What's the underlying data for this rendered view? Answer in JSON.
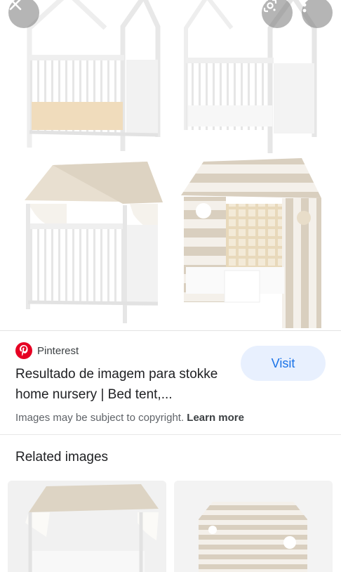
{
  "viewer": {
    "close_icon": "close-icon",
    "lens_icon": "google-lens-icon",
    "more_icon": "more-vert-icon",
    "image_subject": "stokke home nursery crib with bed tent"
  },
  "result": {
    "source_icon": "pinterest-logo",
    "source_name": "Pinterest",
    "title": "Resultado de imagem para stokke home nursery | Bed tent,...",
    "visit_label": "Visit",
    "copyright_text": "Images may be subject to copyright.",
    "learn_more_label": "Learn more"
  },
  "related": {
    "heading": "Related images",
    "thumbnails": [
      {
        "subject": "crib with beige canopy"
      },
      {
        "subject": "striped bed tent"
      }
    ]
  },
  "colors": {
    "accent": "#1a73e8",
    "visit_bg": "#e8f0fe",
    "pinterest_red": "#e60023",
    "tent_stripe": "#d9cfbf"
  }
}
